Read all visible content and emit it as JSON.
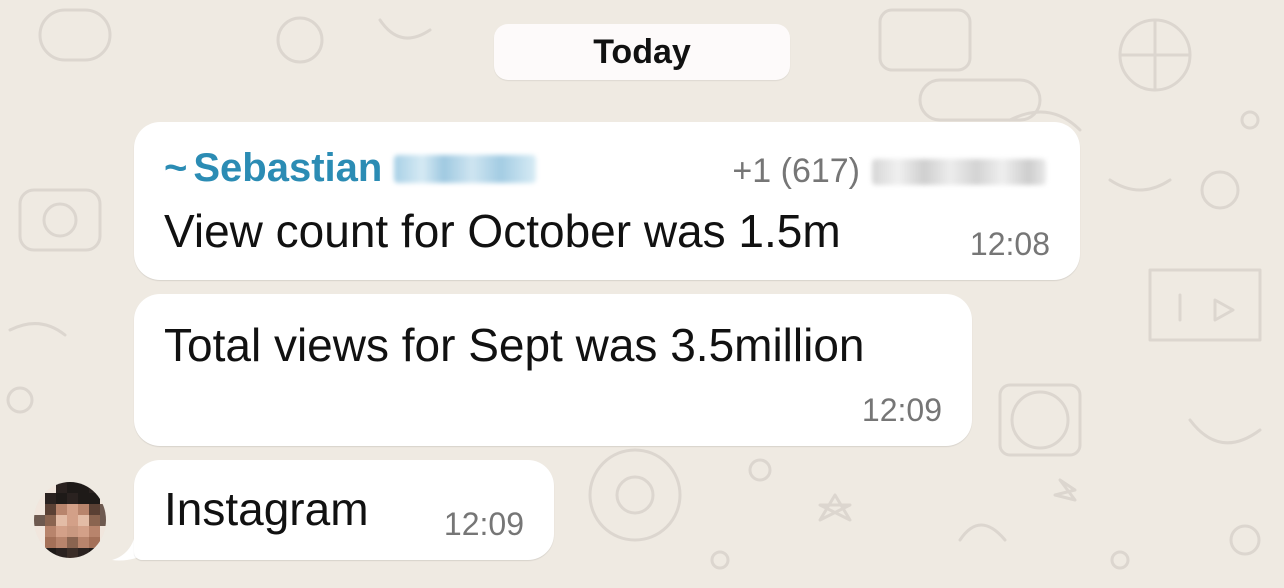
{
  "date_separator": "Today",
  "messages": [
    {
      "sender_name": "Sebastian",
      "sender_prefix": "~",
      "sender_phone_prefix": "+1 (617)",
      "text": "View count for October was 1.5m",
      "time": "12:08"
    },
    {
      "text": "Total views for Sept was 3.5million",
      "time": "12:09"
    },
    {
      "text": "Instagram",
      "time": "12:09"
    }
  ],
  "colors": {
    "background": "#efeae2",
    "bubble": "#ffffff",
    "sender_name": "#2b8cb4",
    "timestamp": "#767676"
  },
  "icons": [
    "sender-avatar"
  ]
}
